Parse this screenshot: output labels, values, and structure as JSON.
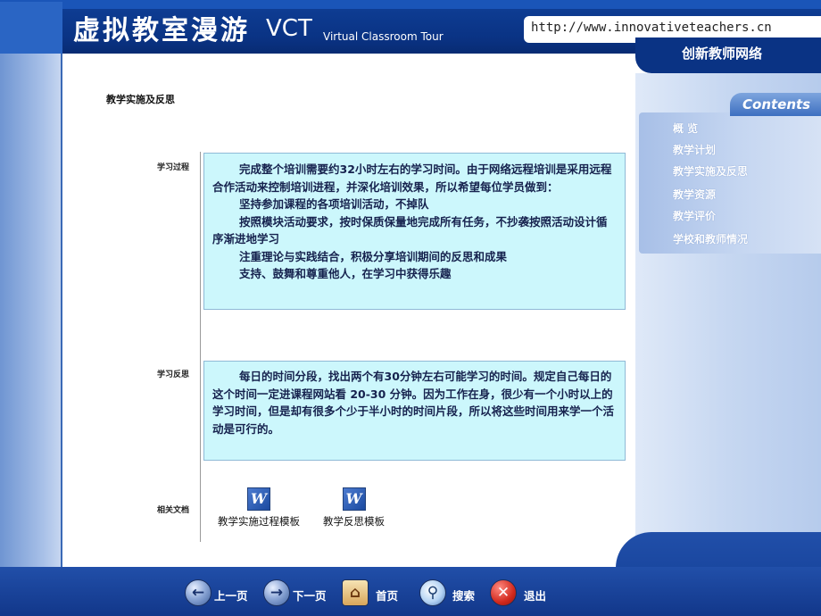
{
  "header": {
    "title": "虚拟教室漫游",
    "vct": "VCT",
    "subtitle": "Virtual Classroom Tour",
    "url": "http://www.innovativeteachers.cn",
    "site_name": "创新教师网络"
  },
  "sidebar": {
    "heading": "Contents",
    "items": [
      {
        "label": "概 览"
      },
      {
        "label": "教学计划"
      },
      {
        "label": "教学实施及反思"
      },
      {
        "label": "教学资源"
      },
      {
        "label": "教学评价"
      },
      {
        "label": "学校和教师情况"
      }
    ]
  },
  "main": {
    "title": "教学实施及反思",
    "sections": {
      "process": {
        "label": "学习过程",
        "paragraphs": [
          "完成整个培训需要约32小时左右的学习时间。由于网络远程培训是采用远程合作活动来控制培训进程，并深化培训效果，所以希望每位学员做到：",
          "坚持参加课程的各项培训活动，不掉队",
          "按照模块活动要求，按时保质保量地完成所有任务，不抄袭按照活动设计循序渐进地学习",
          "注重理论与实践结合，积极分享培训期间的反思和成果",
          "支持、鼓舞和尊重他人，在学习中获得乐趣"
        ]
      },
      "reflection": {
        "label": "学习反思",
        "paragraphs": [
          "每日的时间分段，找出两个有30分钟左右可能学习的时间。规定自己每日的这个时间一定进课程网站看 20-30 分钟。因为工作在身，很少有一个小时以上的学习时间，但是却有很多个少于半小时的时间片段，所以将这些时间用来学一个活动是可行的。"
        ]
      },
      "documents": {
        "label": "相关文档",
        "items": [
          {
            "icon": "word-document-icon",
            "glyph": "W",
            "label": "教学实施过程模板"
          },
          {
            "icon": "word-document-icon",
            "glyph": "W",
            "label": "教学反思模板"
          }
        ]
      }
    }
  },
  "nav": {
    "prev": {
      "label": "上一页",
      "icon": "arrow-left-icon",
      "glyph": "←"
    },
    "next": {
      "label": "下一页",
      "icon": "arrow-right-icon",
      "glyph": "→"
    },
    "home": {
      "label": "首页",
      "icon": "home-icon",
      "glyph": "⌂"
    },
    "search": {
      "label": "搜索",
      "icon": "magnifier-icon",
      "glyph": "⚲"
    },
    "exit": {
      "label": "退出",
      "icon": "exit-icon",
      "glyph": "✕"
    }
  },
  "colors": {
    "frame_blue": "#0a3384",
    "text_box_bg": "#ccf7fc",
    "text_color": "#16224e"
  }
}
